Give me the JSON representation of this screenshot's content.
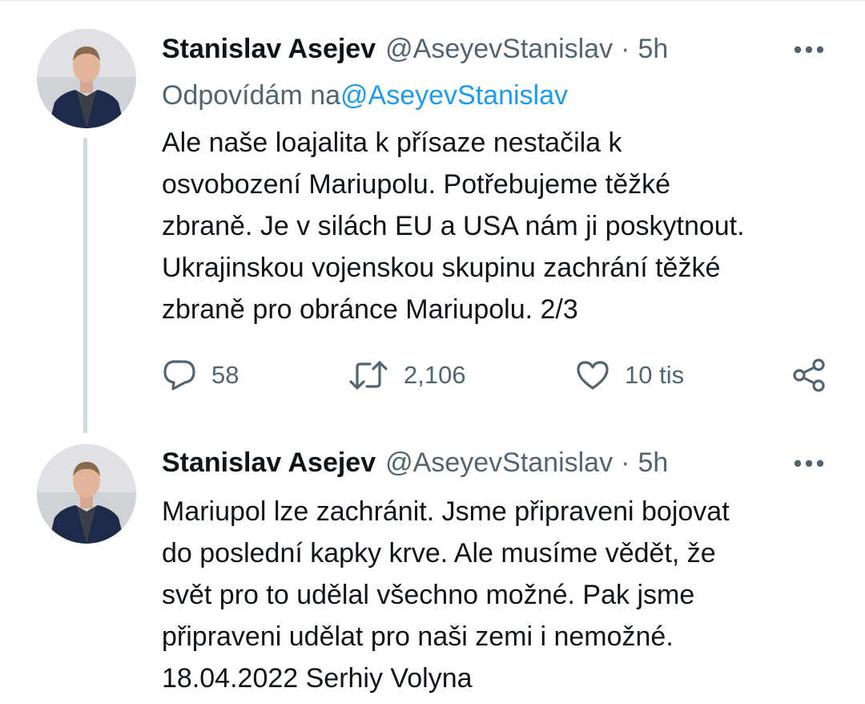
{
  "tweets": [
    {
      "author": {
        "name": "Stanislav Asejev",
        "handle": "@AseyevStanislav"
      },
      "separator": "·",
      "time": "5h",
      "reply_prefix": "Odpovídám na",
      "reply_mention": "@AseyevStanislav",
      "lines": [
        "Ale naše loajalita k přísaze nestačila k",
        "osvobození Mariupolu. Potřebujeme těžké",
        "zbraně. Je v silách EU a USA nám ji poskytnout.",
        "Ukrajinskou vojenskou skupinu zachrání těžké",
        "zbraně pro obránce Mariupolu. 2/3"
      ],
      "stats": {
        "replies": "58",
        "retweets": "2,106",
        "likes": "10 tis"
      }
    },
    {
      "author": {
        "name": "Stanislav Asejev",
        "handle": "@AseyevStanislav"
      },
      "separator": "·",
      "time": "5h",
      "lines": [
        "Mariupol lze zachránit. Jsme připraveni bojovat",
        "do poslední kapky krve. Ale musíme vědět, že",
        "svět pro to udělal všechno možné. Pak jsme",
        "připraveni udělat pro naši zemi i nemožné.",
        "18.04.2022 Serhiy Volyna"
      ]
    }
  ],
  "icons": {
    "more": "more-horizontal-icon",
    "reply": "speech-bubble-icon",
    "retweet": "retweet-arrows-icon",
    "like": "heart-icon",
    "share": "share-nodes-icon"
  },
  "colors": {
    "text": "#0f1419",
    "secondary": "#536471",
    "link": "#1d9bf0",
    "thread_line": "#cfd9de"
  }
}
